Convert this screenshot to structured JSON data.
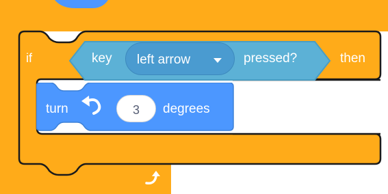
{
  "colors": {
    "control": "#ffab19",
    "control_dark": "#cf8b17",
    "sensing": "#5cb1d6",
    "motion": "#4c97ff",
    "outline": "#1b1b1b"
  },
  "if_block": {
    "if_label": "if",
    "then_label": "then"
  },
  "condition": {
    "key_label": "key",
    "key_value": "left arrow",
    "pressed_label": "pressed?",
    "dropdown_icon": "caret-down-icon"
  },
  "turn_block": {
    "turn_label": "turn",
    "direction_icon": "rotate-left-icon",
    "degrees_value": "3",
    "degrees_label": "degrees"
  },
  "loop_icon": "loop-arrow-icon"
}
